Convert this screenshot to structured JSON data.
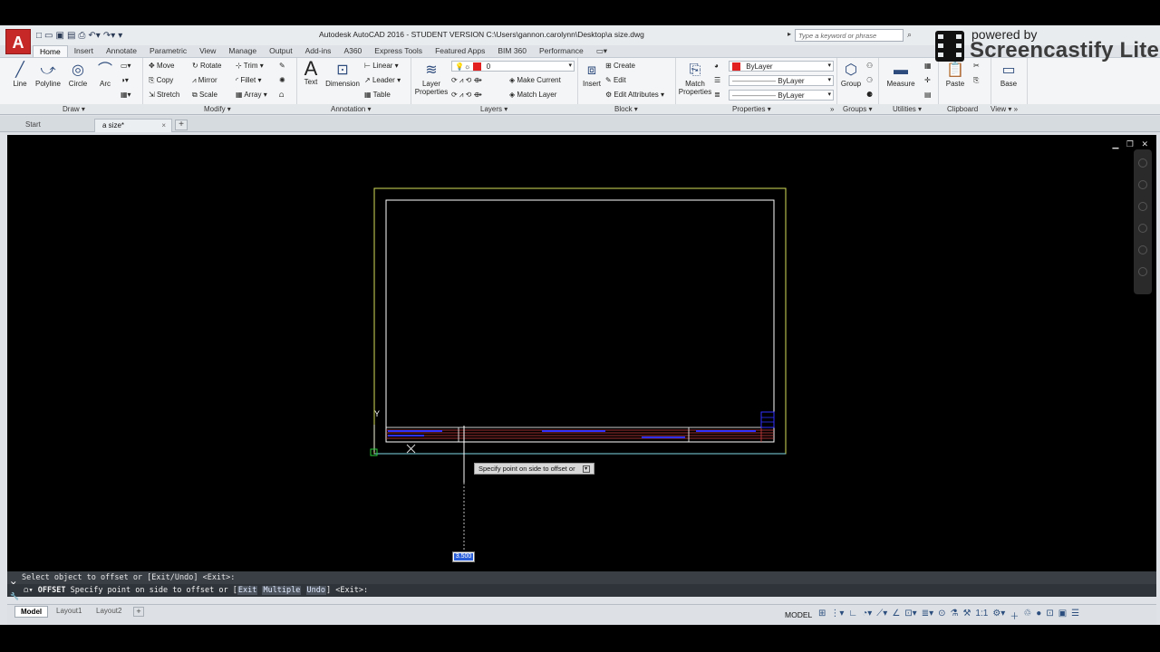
{
  "window": {
    "title": "Autodesk AutoCAD 2016 - STUDENT VERSION    C:\\Users\\gannon.carolynn\\Desktop\\a size.dwg",
    "app_letter": "A",
    "search_placeholder": "Type a keyword or phrase"
  },
  "watermark": {
    "powered": "powered by",
    "brand": "Screencastify Lite"
  },
  "ribbon_tabs": [
    "Home",
    "Insert",
    "Annotate",
    "Parametric",
    "View",
    "Manage",
    "Output",
    "Add-ins",
    "A360",
    "Express Tools",
    "Featured Apps",
    "BIM 360",
    "Performance"
  ],
  "draw_panel": {
    "line": "Line",
    "polyline": "Polyline",
    "circle": "Circle",
    "arc": "Arc",
    "title": "Draw"
  },
  "modify_panel": {
    "move": "Move",
    "rotate": "Rotate",
    "trim": "Trim",
    "copy": "Copy",
    "mirror": "Mirror",
    "fillet": "Fillet",
    "stretch": "Stretch",
    "scale": "Scale",
    "array": "Array",
    "title": "Modify"
  },
  "annotation_panel": {
    "text": "Text",
    "dimension": "Dimension",
    "linear": "Linear",
    "leader": "Leader",
    "table": "Table",
    "title": "Annotation"
  },
  "layers_panel": {
    "layer_properties_1": "Layer",
    "layer_properties_2": "Properties",
    "current_layer": "0",
    "make_current": "Make Current",
    "match_layer": "Match Layer",
    "title": "Layers"
  },
  "block_panel": {
    "insert": "Insert",
    "create": "Create",
    "edit": "Edit",
    "edit_attributes": "Edit Attributes",
    "title": "Block"
  },
  "properties_panel": {
    "match_1": "Match",
    "match_2": "Properties",
    "color": "ByLayer",
    "linetype": "ByLayer",
    "lineweight": "ByLayer",
    "title": "Properties"
  },
  "groups_panel": {
    "group": "Group",
    "title": "Groups"
  },
  "utilities_panel": {
    "measure": "Measure",
    "title": "Utilities"
  },
  "clipboard_panel": {
    "paste": "Paste",
    "title": "Clipboard"
  },
  "view_panel": {
    "base": "Base",
    "title": "View"
  },
  "file_tabs": {
    "start": "Start",
    "current": "a size*"
  },
  "viewport": {
    "tooltip": "Specify point on side to offset or",
    "dynamic_value": "3.500",
    "ucs_y": "Y"
  },
  "command": {
    "history": "Select object to offset or [Exit/Undo] <Exit>:",
    "name": "OFFSET",
    "prompt": "Specify point on side to offset or [",
    "opt_exit": "Exit",
    "opt_multiple": "Multiple",
    "opt_undo": "Undo",
    "suffix": "] <Exit>:"
  },
  "status": {
    "layout_tabs": [
      "Model",
      "Layout1",
      "Layout2"
    ],
    "model_label": "MODEL",
    "scale": "1:1"
  },
  "colors": {
    "viewport_bg": "#000000",
    "border_outer": "#d6e05a",
    "title_block_red": "#d04040",
    "title_block_blue": "#3030ff"
  }
}
